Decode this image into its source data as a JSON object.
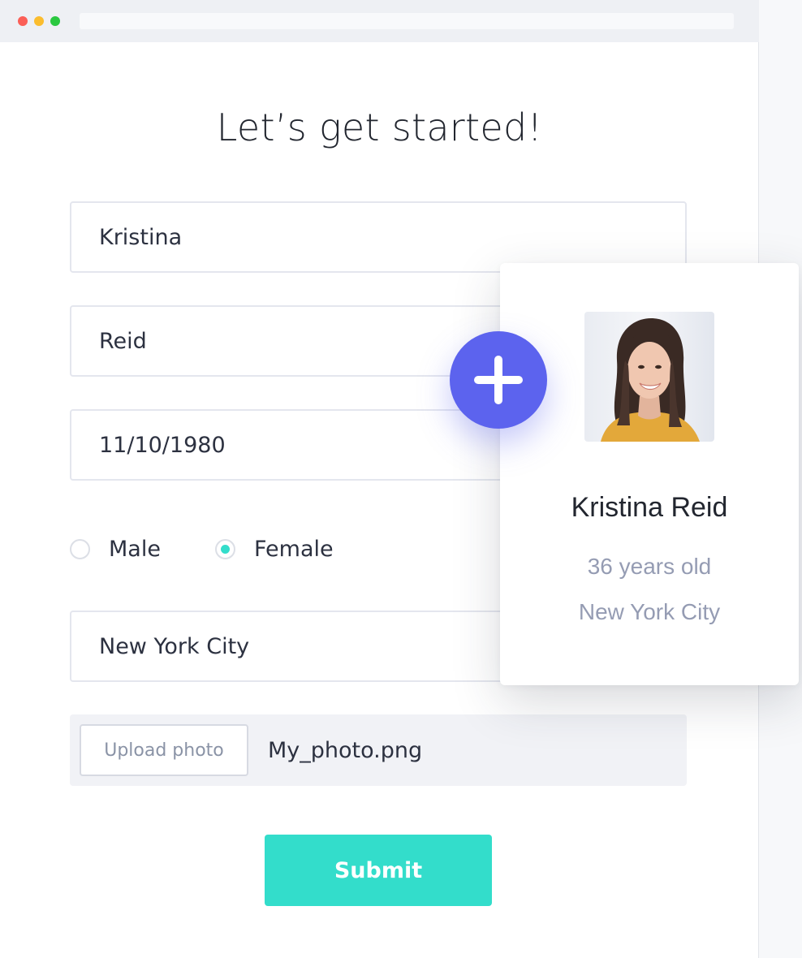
{
  "page": {
    "title": "Let’s get started!"
  },
  "form": {
    "first_name": "Kristina",
    "last_name": "Reid",
    "dob": "11/10/1980",
    "gender_options": [
      "Male",
      "Female"
    ],
    "gender_selected": "Female",
    "city": "New York City",
    "upload_label": "Upload photo",
    "upload_filename": "My_photo.png",
    "submit_label": "Submit"
  },
  "card": {
    "name": "Kristina Reid",
    "age": "36 years old",
    "city": "New York City",
    "add_icon": "plus-icon"
  },
  "colors": {
    "accent": "#33ddcb",
    "fab": "#5c63ee",
    "muted": "#959cb3"
  }
}
